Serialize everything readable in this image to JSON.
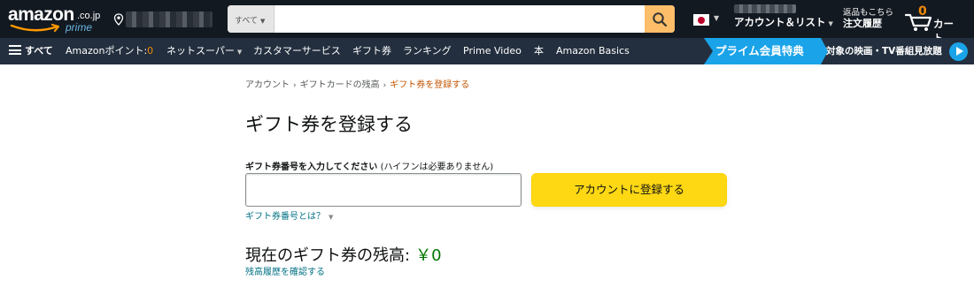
{
  "header": {
    "logo_text": "amazon",
    "logo_tld": ".co.jp",
    "logo_sub": "prime",
    "search": {
      "category": "すべて",
      "placeholder": ""
    },
    "account_label": "アカウント＆リスト",
    "orders_line1": "返品もこちら",
    "orders_line2": "注文履歴",
    "cart_count": "0",
    "cart_label": "カート",
    "colors": {
      "bg": "#131921",
      "search_button": "#febd69",
      "cart_count": "#f08804",
      "prime_blue": "#6cb5e4"
    }
  },
  "nav": {
    "all_label": "すべて",
    "points_label": "Amazonポイント:",
    "points_value": "0",
    "items": [
      "ネットスーパー",
      "カスタマーサービス",
      "ギフト券",
      "ランキング",
      "Prime Video",
      "本",
      "Amazon Basics"
    ],
    "prime_banner": "プライム会員特典",
    "promo": "対象の映画・TV番組見放題",
    "colors": {
      "bg": "#232f3e",
      "banner": "#1aa3e8"
    }
  },
  "breadcrumb": {
    "items": [
      "アカウント",
      "ギフトカードの残高",
      "ギフト券を登録する"
    ],
    "separator": "›"
  },
  "main": {
    "title": "ギフト券を登録する",
    "field_label_bold": "ギフト券番号を入力してください",
    "field_label_note": "(ハイフンは必要ありません)",
    "code_value": "",
    "help_link": "ギフト券番号とは？",
    "register_button": "アカウントに登録する",
    "balance_label": "現在のギフト券の残高:",
    "balance_value": "￥0",
    "history_link": "残高履歴を確認する",
    "colors": {
      "button": "#ffd814",
      "link": "#007185",
      "balance": "#007600",
      "breadcrumb_current": "#c45500"
    }
  }
}
